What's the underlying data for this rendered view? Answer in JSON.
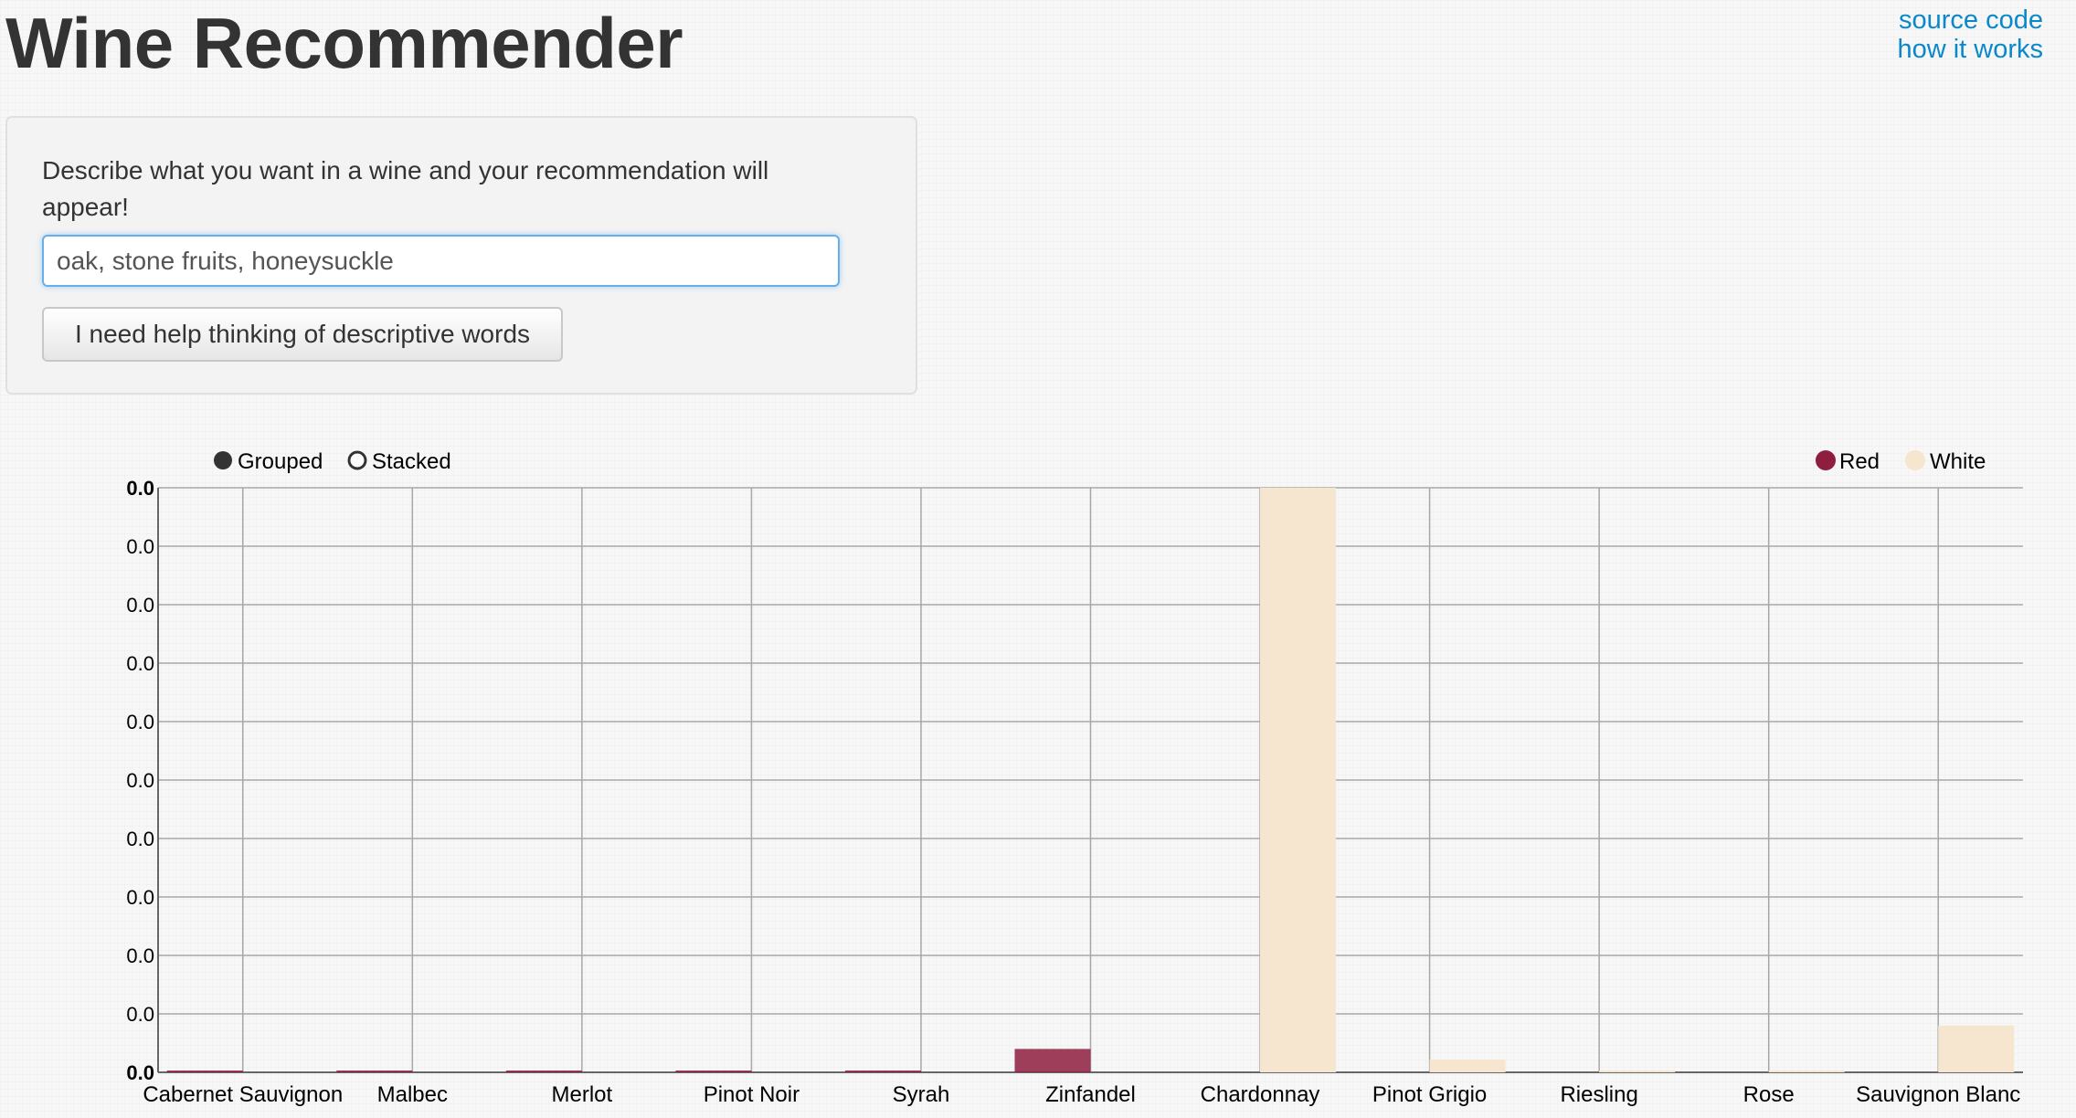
{
  "page": {
    "title": "Wine Recommender",
    "links": {
      "source_code": "source code",
      "how_it_works": "how it works"
    }
  },
  "panel": {
    "prompt": "Describe what you want in a wine and your recommendation will appear!",
    "search_value": "oak, stone fruits, honeysuckle",
    "help_button": "I need help thinking of descriptive words"
  },
  "controls": {
    "modes": [
      {
        "label": "Grouped",
        "selected": true
      },
      {
        "label": "Stacked",
        "selected": false
      }
    ]
  },
  "colors": {
    "red": "#8e1d3e",
    "white": "#f6e6cf",
    "link": "#0a88cc"
  },
  "chart_data": {
    "type": "bar",
    "categories": [
      "Cabernet Sauvignon",
      "Malbec",
      "Merlot",
      "Pinot Noir",
      "Syrah",
      "Zinfandel",
      "Chardonnay",
      "Pinot Grigio",
      "Riesling",
      "Rose",
      "Sauvignon Blanc"
    ],
    "series": [
      {
        "name": "Red",
        "color": "#8e1d3e",
        "values": [
          0.003,
          0.003,
          0.003,
          0.003,
          0.003,
          0.04,
          0,
          0,
          0,
          0,
          0
        ]
      },
      {
        "name": "White",
        "color": "#f6e6cf",
        "values": [
          0,
          0,
          0,
          0,
          0,
          0,
          1.0,
          0.022,
          0.002,
          0.002,
          0.08
        ]
      }
    ],
    "ylim": [
      0,
      1.0
    ],
    "y_tick_labels": [
      "0.0",
      "0.0",
      "0.0",
      "0.0",
      "0.0",
      "0.0",
      "0.0",
      "0.0",
      "0.0",
      "0.0",
      "0.0"
    ],
    "grid": true,
    "legend_position": "top-right",
    "mode": "grouped"
  }
}
